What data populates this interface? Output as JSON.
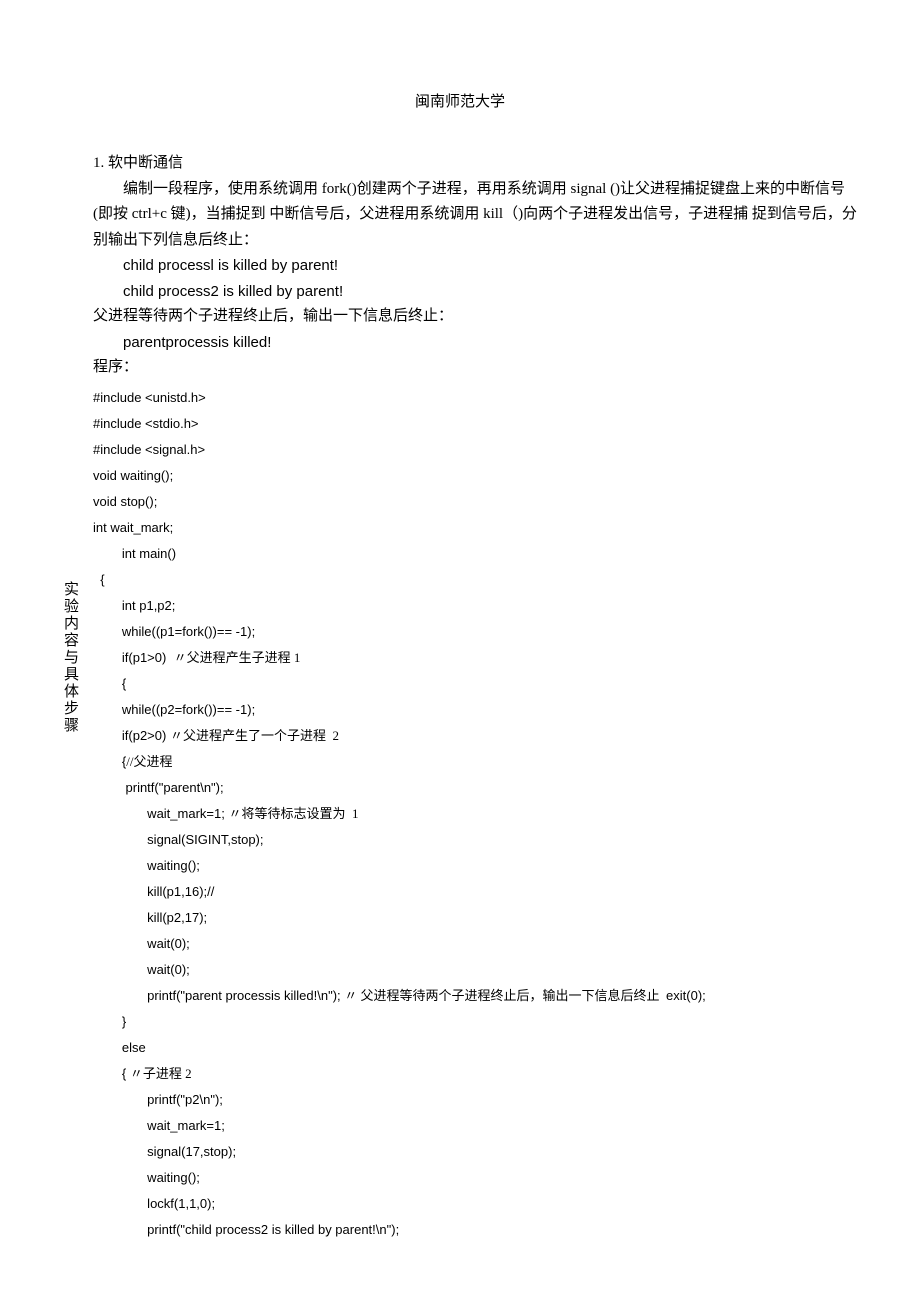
{
  "header": "闽南师范大学",
  "sidebar": "实验内容与具体步骤",
  "section_title": "1. 软中断通信",
  "para1": "编制一段程序，使用系统调用 fork()创建两个子进程，再用系统调用  signal ()让父进程捕捉键盘上来的中断信号(即按 ctrl+c 键)，当捕捉到 中断信号后，父进程用系统调用 kill（)向两个子进程发出信号，子进程捕  捉到信号后，分别输出下列信息后终止：",
  "line_child1": "child processl is killed by parent!",
  "line_child2": "child process2 is killed by parent!",
  "para2": "父进程等待两个子进程终止后，输出一下信息后终止：",
  "line_parent": "parentprocessis killed!",
  "program_label": "程序：",
  "code": {
    "l01": "#include <unistd.h>",
    "l02": "#include <stdio.h>",
    "l03": "#include <signal.h>",
    "l04": "void waiting();",
    "l05": "void stop();",
    "l06": "int wait_mark;",
    "l07": "        int main()",
    "l08": "  {",
    "l09": "        int p1,p2;",
    "l10": "        while((p1=fork())== -1);",
    "l11a": "        if(p1>0)  ",
    "l11b": "〃父进程产生子进程 1",
    "l12": "        {",
    "l13": "        while((p2=fork())== -1);",
    "l14a": "        if(p2>0) ",
    "l14b": "〃父进程产生了一个子进程  2",
    "l15a": "        {",
    "l15b": "//父进程",
    "l16": "         printf(\"parent\\n\");",
    "l17a": "               wait_mark=1; ",
    "l17b": "〃将等待标志设置为  1",
    "l18": "               signal(SIGINT,stop);",
    "l19": "               waiting();",
    "l20": "               kill(p1,16);//",
    "l21": "               kill(p2,17);",
    "l22": "               wait(0);",
    "l23": "               wait(0);",
    "l24a": "               printf(\"parent processis killed!\\n\"); ",
    "l24b": "〃 父进程等待两个子进程终止后，输出一下信息后终止  ",
    "l24c": "exit(0);",
    "l25": "        }",
    "l26": "        else",
    "l27a": "        { ",
    "l27b": "〃子进程 2",
    "l28": "               printf(\"p2\\n\");",
    "l29": "               wait_mark=1;",
    "l30": "               signal(17,stop);",
    "l31": "               waiting();",
    "l32": "               lockf(1,1,0);",
    "l33": "               printf(\"child process2 is killed by parent!\\n\");"
  }
}
